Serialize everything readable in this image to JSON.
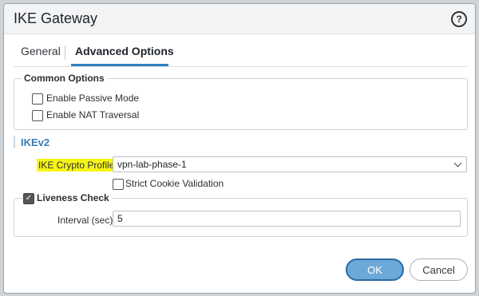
{
  "dialog": {
    "title": "IKE Gateway",
    "help_icon": "question-mark-icon"
  },
  "tabs": [
    {
      "label": "General",
      "active": false
    },
    {
      "label": "Advanced Options",
      "active": true
    }
  ],
  "common_options": {
    "title": "Common Options",
    "enable_passive_mode": {
      "label": "Enable Passive Mode",
      "checked": false
    },
    "enable_nat_traversal": {
      "label": "Enable NAT Traversal",
      "checked": false
    }
  },
  "ikev2": {
    "section_label": "IKEv2",
    "crypto_profile": {
      "label": "IKE Crypto Profile",
      "value": "vpn-lab-phase-1"
    },
    "strict_cookie_validation": {
      "label": "Strict Cookie Validation",
      "checked": false
    },
    "liveness_check": {
      "label": "Liveness Check",
      "checked": true,
      "interval_label": "Interval (sec)",
      "interval_value": "5"
    }
  },
  "buttons": {
    "ok": "OK",
    "cancel": "Cancel"
  },
  "colors": {
    "accent": "#2f80c1",
    "highlight": "#f7f516",
    "ok_button": "#6ca9d8"
  }
}
